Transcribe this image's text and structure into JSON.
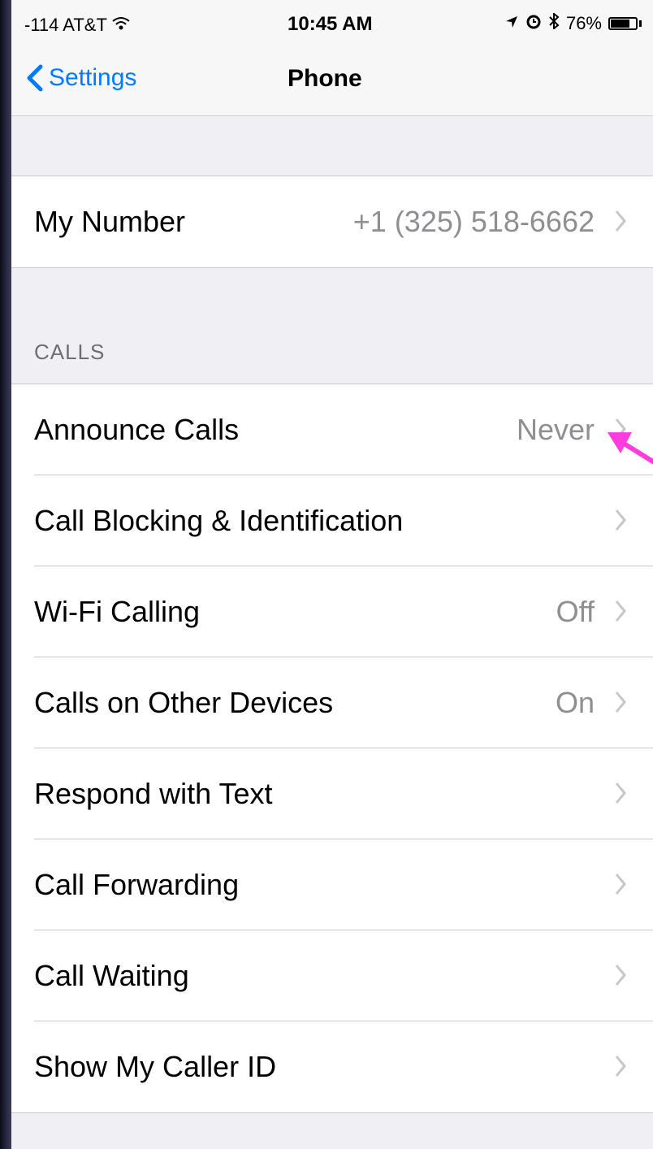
{
  "status_bar": {
    "carrier": "-114 AT&T",
    "time": "10:45 AM",
    "battery_text": "76%",
    "battery_level": 0.76,
    "icons": [
      "wifi-icon",
      "location-icon",
      "alarm-icon",
      "bluetooth-icon",
      "battery-icon"
    ]
  },
  "nav": {
    "back_label": "Settings",
    "title": "Phone"
  },
  "my_number": {
    "label": "My Number",
    "value": "+1 (325) 518-6662"
  },
  "calls_section": {
    "header": "CALLS",
    "items": [
      {
        "label": "Announce Calls",
        "value": "Never"
      },
      {
        "label": "Call Blocking & Identification",
        "value": ""
      },
      {
        "label": "Wi-Fi Calling",
        "value": "Off"
      },
      {
        "label": "Calls on Other Devices",
        "value": "On"
      },
      {
        "label": "Respond with Text",
        "value": ""
      },
      {
        "label": "Call Forwarding",
        "value": ""
      },
      {
        "label": "Call Waiting",
        "value": ""
      },
      {
        "label": "Show My Caller ID",
        "value": ""
      }
    ]
  },
  "colors": {
    "accent": "#007aff",
    "annotation_arrow": "#ff3ddc",
    "background": "#efeff4"
  }
}
